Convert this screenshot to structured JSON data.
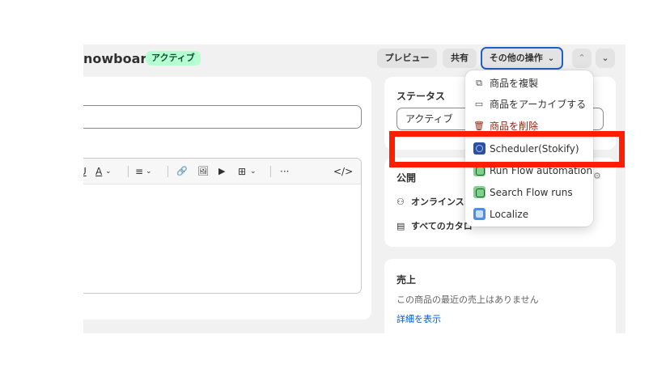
{
  "header": {
    "title": "nowboard",
    "status_badge": "アクティブ",
    "preview_label": "プレビュー",
    "share_label": "共有",
    "more_actions_label": "その他の操作",
    "prev_icon": "chevron-up-icon",
    "next_icon": "chevron-down-icon"
  },
  "editor": {
    "toolbar": [
      "U",
      "A",
      "≡",
      "🔗",
      "🖼",
      "▶",
      "⊞",
      "···",
      "</>"
    ]
  },
  "status_card": {
    "title": "ステータス",
    "selected": "アクティブ"
  },
  "publish_card": {
    "title": "公開",
    "online_store": "オンラインス",
    "catalog": "すべてのカタロ"
  },
  "sales_card": {
    "title": "売上",
    "text": "この商品の最近の売上はありません",
    "link": "詳細を表示"
  },
  "menu": {
    "items": [
      {
        "label": "商品を複製",
        "icon": "duplicate-icon"
      },
      {
        "label": "商品をアーカイブする",
        "icon": "archive-icon"
      },
      {
        "label": "商品を削除",
        "icon": "trash-icon"
      },
      {
        "label": "Scheduler(Stokify)",
        "icon": "stokify-app-icon"
      },
      {
        "label": "Run Flow automation",
        "icon": "flow-app-icon"
      },
      {
        "label": "Search Flow runs",
        "icon": "flow-app-icon"
      },
      {
        "label": "Localize",
        "icon": "localize-app-icon"
      }
    ]
  },
  "colors": {
    "accent": "#1f5fc7",
    "badge_bg": "#b4fed2",
    "highlight": "#ff1f00",
    "danger": "#8e1f0b"
  }
}
